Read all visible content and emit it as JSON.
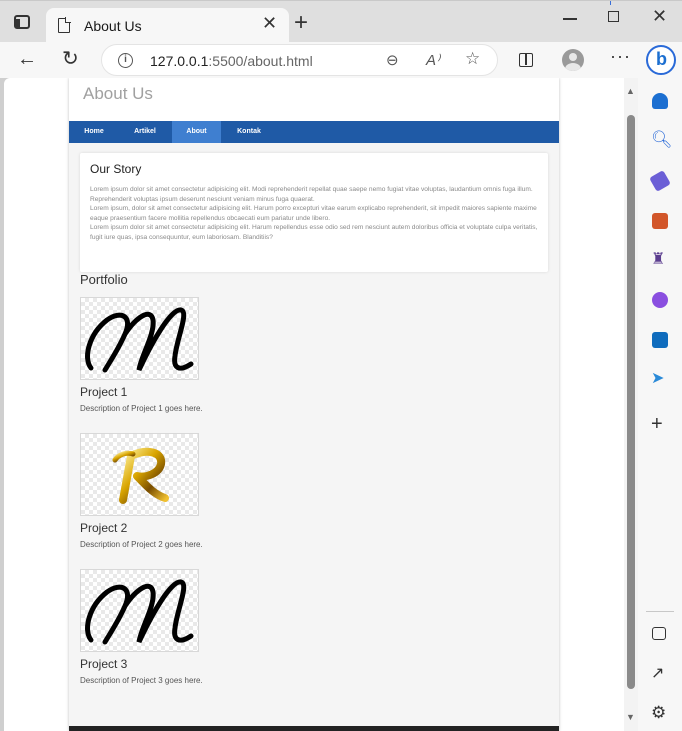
{
  "browser": {
    "tab_title": "About Us",
    "url_host": "127.0.0.1",
    "url_rest": ":5500/about.html",
    "icons": [
      "tab-actions-icon",
      "document-icon",
      "close-icon",
      "plus-icon",
      "back-icon",
      "refresh-icon",
      "info-icon",
      "zoom-out-icon",
      "read-aloud-icon",
      "favorite-star-icon",
      "split-screen-icon",
      "profile-icon",
      "more-icon",
      "bing-icon"
    ]
  },
  "site": {
    "title": "About Us",
    "nav": [
      "Home",
      "Artikel",
      "About",
      "Kontak"
    ],
    "active_nav": "About",
    "nav_color": "#1f5aa6",
    "active_nav_color": "#3f7fd0"
  },
  "story": {
    "heading": "Our Story",
    "body": "Lorem ipsum dolor sit amet consectetur adipisicing elit. Modi reprehenderit repellat quae saepe nemo fugiat vitae voluptas, laudantium omnis fuga illum. Reprehenderit voluptas ipsum deserunt nesciunt veniam minus fuga quaerat.\nLorem ipsum, dolor sit amet consectetur adipisicing elit. Harum porro excepturi vitae earum explicabo reprehenderit, sit impedit maiores sapiente maxime eaque praesentium facere mollitia repellendus obcaecati eum pariatur unde libero.\nLorem ipsum dolor sit amet consectetur adipisicing elit. Harum repellendus esse odio sed rem nesciunt autem doloribus officia et voluptate culpa veritatis, fugit iure quas, ipsa consequuntur, eum laboriosam. Blanditiis?"
  },
  "portfolio": {
    "title": "Portfolio",
    "projects": [
      {
        "title": "Project 1",
        "description": "Description of Project 1 goes here.",
        "image_letter": "M"
      },
      {
        "title": "Project 2",
        "description": "Description of Project 2 goes here.",
        "image_letter": "R"
      },
      {
        "title": "Project 3",
        "description": "Description of Project 3 goes here.",
        "image_letter": "M"
      }
    ]
  },
  "sidebar_icons": [
    "bell-icon",
    "search-icon",
    "shopping-tag-icon",
    "toolbox-icon",
    "games-icon",
    "microsoft365-icon",
    "outlook-icon",
    "send-icon",
    "add-icon",
    "sidebar-toggle-icon",
    "open-external-icon",
    "settings-icon"
  ]
}
